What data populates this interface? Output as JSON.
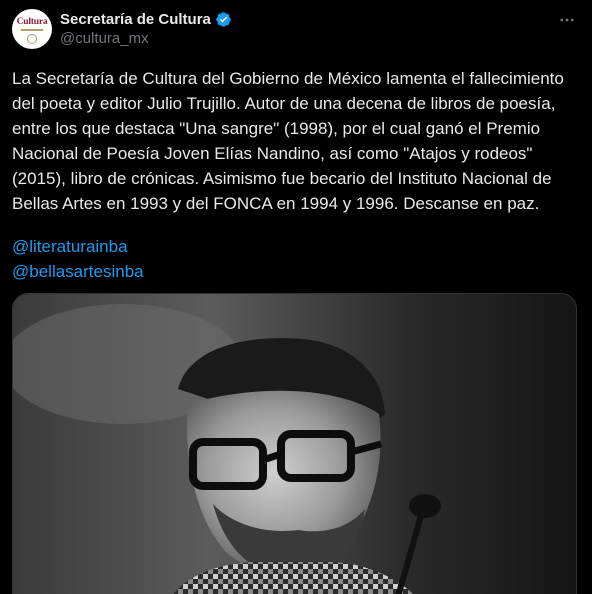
{
  "account": {
    "display_name": "Secretaría de Cultura",
    "handle": "@cultura_mx",
    "avatar_text": "Cultura",
    "verified_color": "#1d9bf0"
  },
  "tweet": {
    "text": "La Secretaría de Cultura del Gobierno de México lamenta el fallecimiento del poeta y editor Julio Trujillo. Autor de una decena de libros de poesía, entre los que destaca \"Una sangre\" (1998), por el cual ganó el Premio Nacional de Poesía Joven Elías Nandino, así como \"Atajos y rodeos\" (2015), libro de crónicas. Asimismo fue becario del Instituto Nacional de Bellas Artes en 1993 y del FONCA en 1994 y 1996. Descanse en paz.",
    "mentions": [
      "@literaturainba",
      "@bellasartesinba"
    ]
  },
  "icons": {
    "verified": "verified-badge-icon",
    "more": "more-options-icon"
  },
  "colors": {
    "background": "#000000",
    "text": "#e7e9ea",
    "secondary": "#71767b",
    "link": "#1d9bf0",
    "brand": "#8a1d3a"
  }
}
